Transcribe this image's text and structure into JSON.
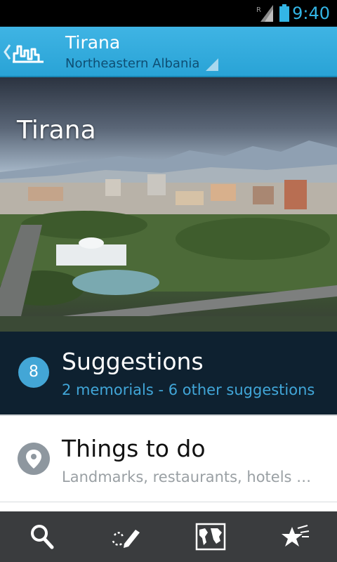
{
  "status_bar": {
    "time": "9:40",
    "roaming_label": "R",
    "icons": [
      "signal-icon",
      "battery-icon"
    ]
  },
  "action_bar": {
    "title": "Tirana",
    "subtitle": "Northeastern Albania",
    "up_icon": "back-chevron-icon",
    "logo_icon": "city-skyline-logo-icon"
  },
  "hero": {
    "title": "Tirana"
  },
  "suggestions": {
    "count": "8",
    "title": "Suggestions",
    "subtitle": "2 memorials - 6 other suggestions"
  },
  "things_to_do": {
    "title": "Things to do",
    "subtitle": "Landmarks, restaurants, hotels …",
    "icon": "map-pin-icon"
  },
  "bottom_bar": {
    "items": [
      {
        "icon": "search-icon"
      },
      {
        "icon": "draw-route-icon"
      },
      {
        "icon": "world-map-icon"
      },
      {
        "icon": "favorites-star-icon"
      }
    ]
  },
  "colors": {
    "accent": "#33b5e5",
    "action_bar": "#2ea8db",
    "suggestions_bg": "#0e2130",
    "badge": "#43a6d6",
    "bottom_bar": "#3a3c3e"
  }
}
